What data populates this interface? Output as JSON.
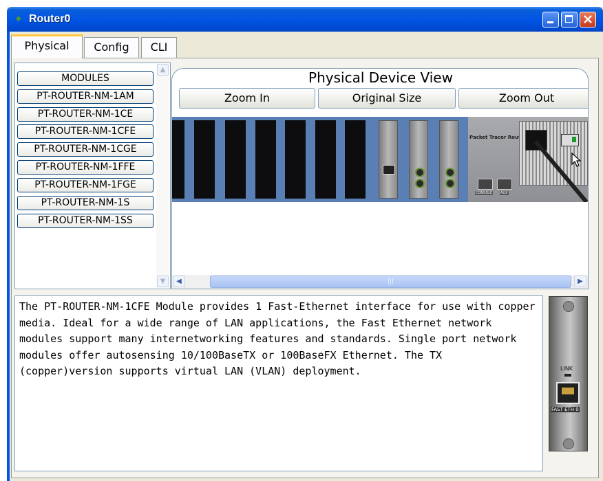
{
  "window": {
    "title": "Router0"
  },
  "tabs": [
    {
      "label": "Physical",
      "active": true
    },
    {
      "label": "Config",
      "active": false
    },
    {
      "label": "CLI",
      "active": false
    }
  ],
  "modules": {
    "header": "MODULES",
    "items": [
      "PT-ROUTER-NM-1AM",
      "PT-ROUTER-NM-1CE",
      "PT-ROUTER-NM-1CFE",
      "PT-ROUTER-NM-1CGE",
      "PT-ROUTER-NM-1FFE",
      "PT-ROUTER-NM-1FGE",
      "PT-ROUTER-NM-1S",
      "PT-ROUTER-NM-1SS"
    ]
  },
  "physical_view": {
    "title": "Physical Device View",
    "zoom_in": "Zoom In",
    "original_size": "Original Size",
    "zoom_out": "Zoom Out",
    "device_label": "Packet Tracer Router",
    "console_label": "CONSOLE",
    "aux_label": "AUX"
  },
  "description": "The PT-ROUTER-NM-1CFE Module provides 1 Fast-Ethernet interface for use with copper media. Ideal for a wide range of LAN applications, the Fast Ethernet network modules support many internetworking features and standards. Single port network modules offer autosensing 10/100BaseTX or 100BaseFX Ethernet. The TX (copper)version supports virtual LAN (VLAN) deployment.",
  "module_preview": {
    "link_label": "LINK",
    "port_label": "FAST ETH 0"
  },
  "colors": {
    "titlebar": "#0054e3",
    "tab_highlight": "#ffc83c",
    "rack": "#1f2026",
    "chassis": "#5a7fb5"
  }
}
